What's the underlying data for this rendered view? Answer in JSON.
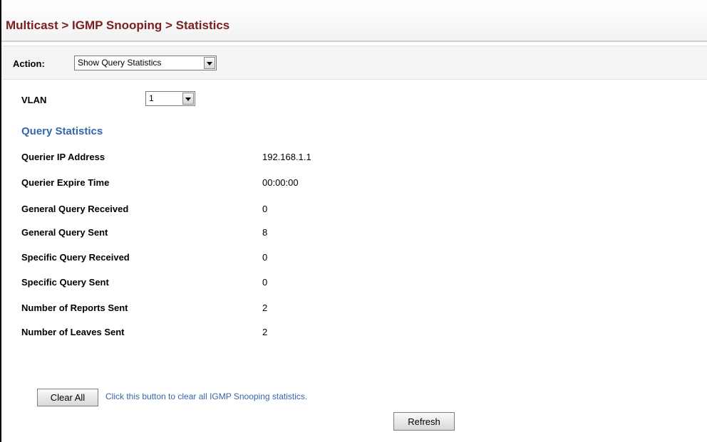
{
  "page": {
    "breadcrumb": "Multicast > IGMP Snooping > Statistics",
    "colors": {
      "title": "#7a1f1f",
      "section": "#3366aa"
    }
  },
  "action": {
    "label": "Action:",
    "selected": "Show Query Statistics"
  },
  "vlan": {
    "label": "VLAN",
    "selected": "1"
  },
  "query_statistics": {
    "heading": "Query Statistics",
    "rows": [
      {
        "label": "Querier IP Address",
        "value": "192.168.1.1"
      },
      {
        "label": "Querier Expire Time",
        "value": "00:00:00"
      },
      {
        "label": "General Query Received",
        "value": "0"
      },
      {
        "label": "General Query Sent",
        "value": "8"
      },
      {
        "label": "Specific Query Received",
        "value": "0"
      },
      {
        "label": "Specific Query Sent",
        "value": "0"
      },
      {
        "label": "Number of Reports Sent",
        "value": "2"
      },
      {
        "label": "Number of Leaves Sent",
        "value": "2"
      }
    ]
  },
  "buttons": {
    "clear_all": "Clear All",
    "clear_all_hint": "Click this button to clear all IGMP Snooping statistics.",
    "refresh": "Refresh"
  }
}
